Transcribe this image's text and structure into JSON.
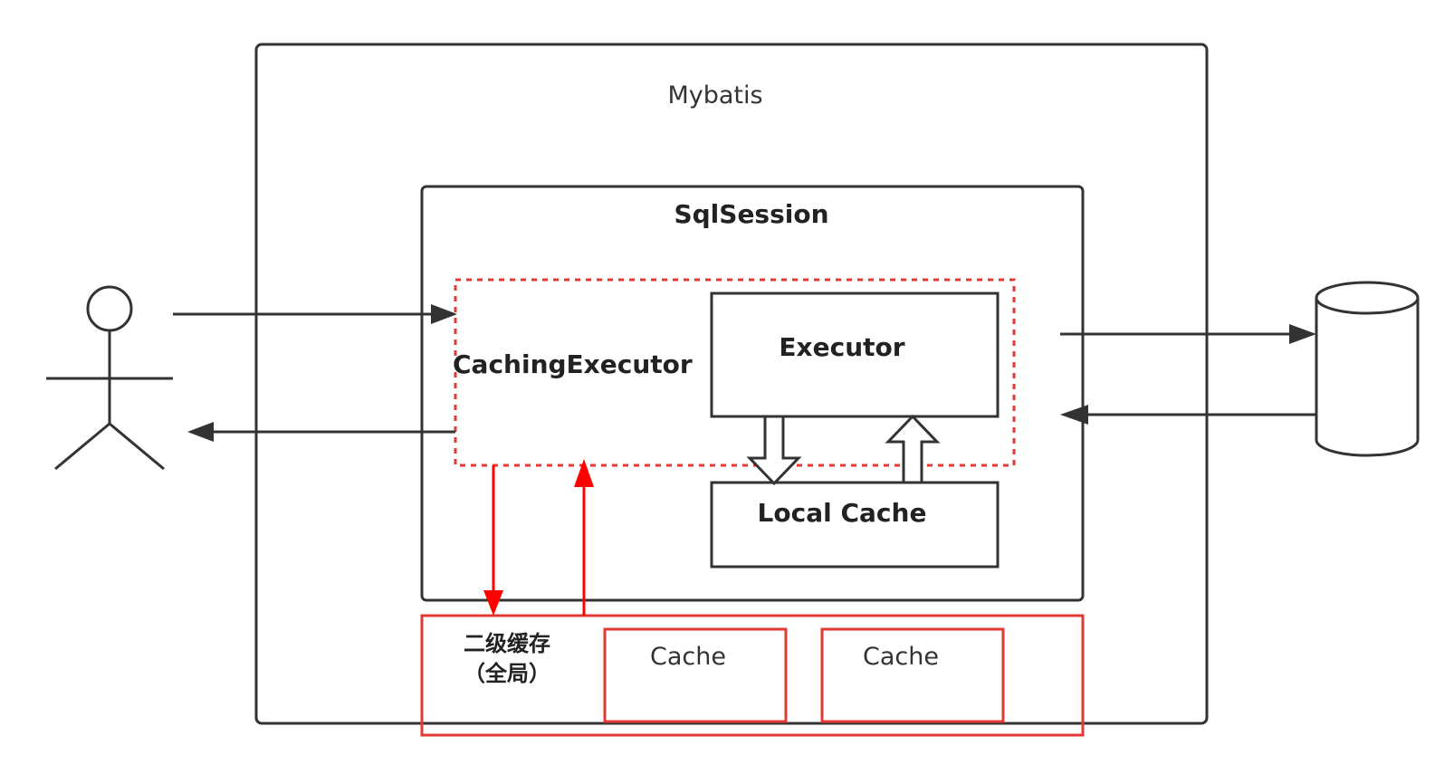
{
  "diagram": {
    "outer_title": "Mybatis",
    "session_title": "SqlSession",
    "caching_executor": "CachingExecutor",
    "executor": "Executor",
    "local_cache": "Local Cache",
    "second_level_cache": "二级缓存\n（全局）",
    "cache_1": "Cache",
    "cache_2": "Cache"
  },
  "colors": {
    "stroke": "#333333",
    "accent_red": "#e53935",
    "arrow_red": "#ff0000"
  },
  "icons": [
    "user-actor-icon",
    "database-icon"
  ]
}
